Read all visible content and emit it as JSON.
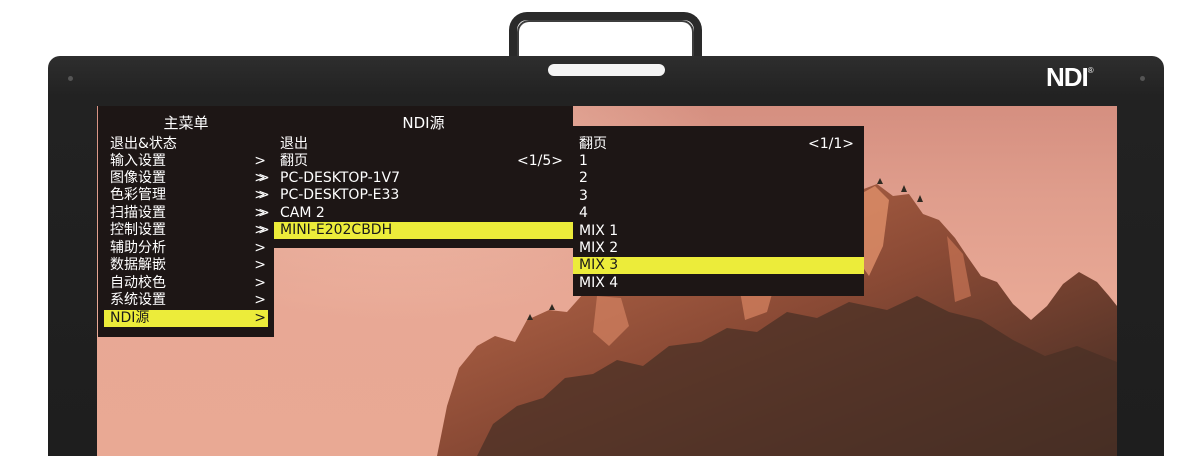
{
  "brand": {
    "logo_text": "NDI",
    "logo_mark": "®"
  },
  "main_menu": {
    "title": "主菜单",
    "items": [
      {
        "label": "退出&状态",
        "arrow": ""
      },
      {
        "label": "输入设置",
        "arrow": ">"
      },
      {
        "label": "图像设置",
        "arrow": ">"
      },
      {
        "label": "色彩管理",
        "arrow": ">"
      },
      {
        "label": "扫描设置",
        "arrow": ">"
      },
      {
        "label": "控制设置",
        "arrow": ">"
      },
      {
        "label": "辅助分析",
        "arrow": ">"
      },
      {
        "label": "数据解嵌",
        "arrow": ">"
      },
      {
        "label": "自动校色",
        "arrow": ">"
      },
      {
        "label": "系统设置",
        "arrow": ">"
      },
      {
        "label": "NDI源",
        "arrow": ">"
      }
    ],
    "selected_index": 10
  },
  "ndi_menu": {
    "title": "NDI源",
    "exit_label": "退出",
    "page_label": "翻页",
    "page_value": "<1/5>",
    "sources": [
      {
        "arrow": ">",
        "label": "PC-DESKTOP-1V7"
      },
      {
        "arrow": ">",
        "label": "PC-DESKTOP-E33"
      },
      {
        "arrow": ">",
        "label": "CAM 2"
      },
      {
        "arrow": ">",
        "label": "MINI-E202CBDH"
      }
    ],
    "selected_source_index": 3
  },
  "page_menu": {
    "page_label": "翻页",
    "page_value": "<1/1>",
    "items": [
      "1",
      "2",
      "3",
      "4",
      "MIX 1",
      "MIX 2",
      "MIX 3",
      "MIX 4"
    ],
    "selected_index": 6
  },
  "colors": {
    "menu_bg": "#1d1615",
    "highlight": "#ecec3a",
    "bezel": "#222222",
    "sky": "#e3a290"
  },
  "icons": [
    "monitor-handle",
    "power-indicator",
    "ndi-logo"
  ]
}
